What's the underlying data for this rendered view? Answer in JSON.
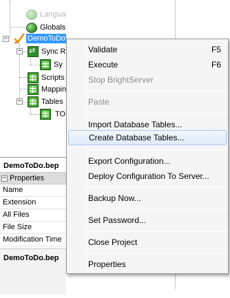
{
  "tree": {
    "nodes": {
      "languages": "Languages",
      "globals": "Globals",
      "project": "DemoToDo.b",
      "sync_rules": "Sync R",
      "sync_child": "Sy",
      "scripts": "Scripts",
      "mappings": "Mappin",
      "tables": "Tables",
      "table_child": "TO"
    }
  },
  "properties": {
    "title": "DemoToDo.bep",
    "category": "Properties",
    "rows": [
      "Name",
      "Extension",
      "All Files",
      "File Size",
      "Modification Time"
    ],
    "footer": "DemoToDo.bep"
  },
  "context_menu": {
    "items": [
      {
        "label": "Validate",
        "shortcut": "F5",
        "disabled": false,
        "highlight": false
      },
      {
        "label": "Execute",
        "shortcut": "F6",
        "disabled": false,
        "highlight": false
      },
      {
        "label": "Stop BrightServer",
        "shortcut": "",
        "disabled": true,
        "highlight": false
      },
      {
        "label": "Paste",
        "shortcut": "",
        "disabled": true,
        "highlight": false
      },
      {
        "label": "Import Database Tables...",
        "shortcut": "",
        "disabled": false,
        "highlight": false
      },
      {
        "label": "Create Database Tables...",
        "shortcut": "",
        "disabled": false,
        "highlight": true
      },
      {
        "label": "Export Configuration...",
        "shortcut": "",
        "disabled": false,
        "highlight": false
      },
      {
        "label": "Deploy Configuration To Server...",
        "shortcut": "",
        "disabled": false,
        "highlight": false
      },
      {
        "label": "Backup Now...",
        "shortcut": "",
        "disabled": false,
        "highlight": false
      },
      {
        "label": "Set Password...",
        "shortcut": "",
        "disabled": false,
        "highlight": false
      },
      {
        "label": "Close Project",
        "shortcut": "",
        "disabled": false,
        "highlight": false
      },
      {
        "label": "Properties",
        "shortcut": "",
        "disabled": false,
        "highlight": false
      }
    ]
  },
  "icons": {
    "globals": "globe-icon",
    "project": "project-check-icon",
    "sync_rules": "sync-icon",
    "grid": "table-grid-icon"
  },
  "colors": {
    "selection": "#3399ff",
    "menu_highlight": "#dfeafa",
    "disabled_text": "#8d8d8d"
  }
}
